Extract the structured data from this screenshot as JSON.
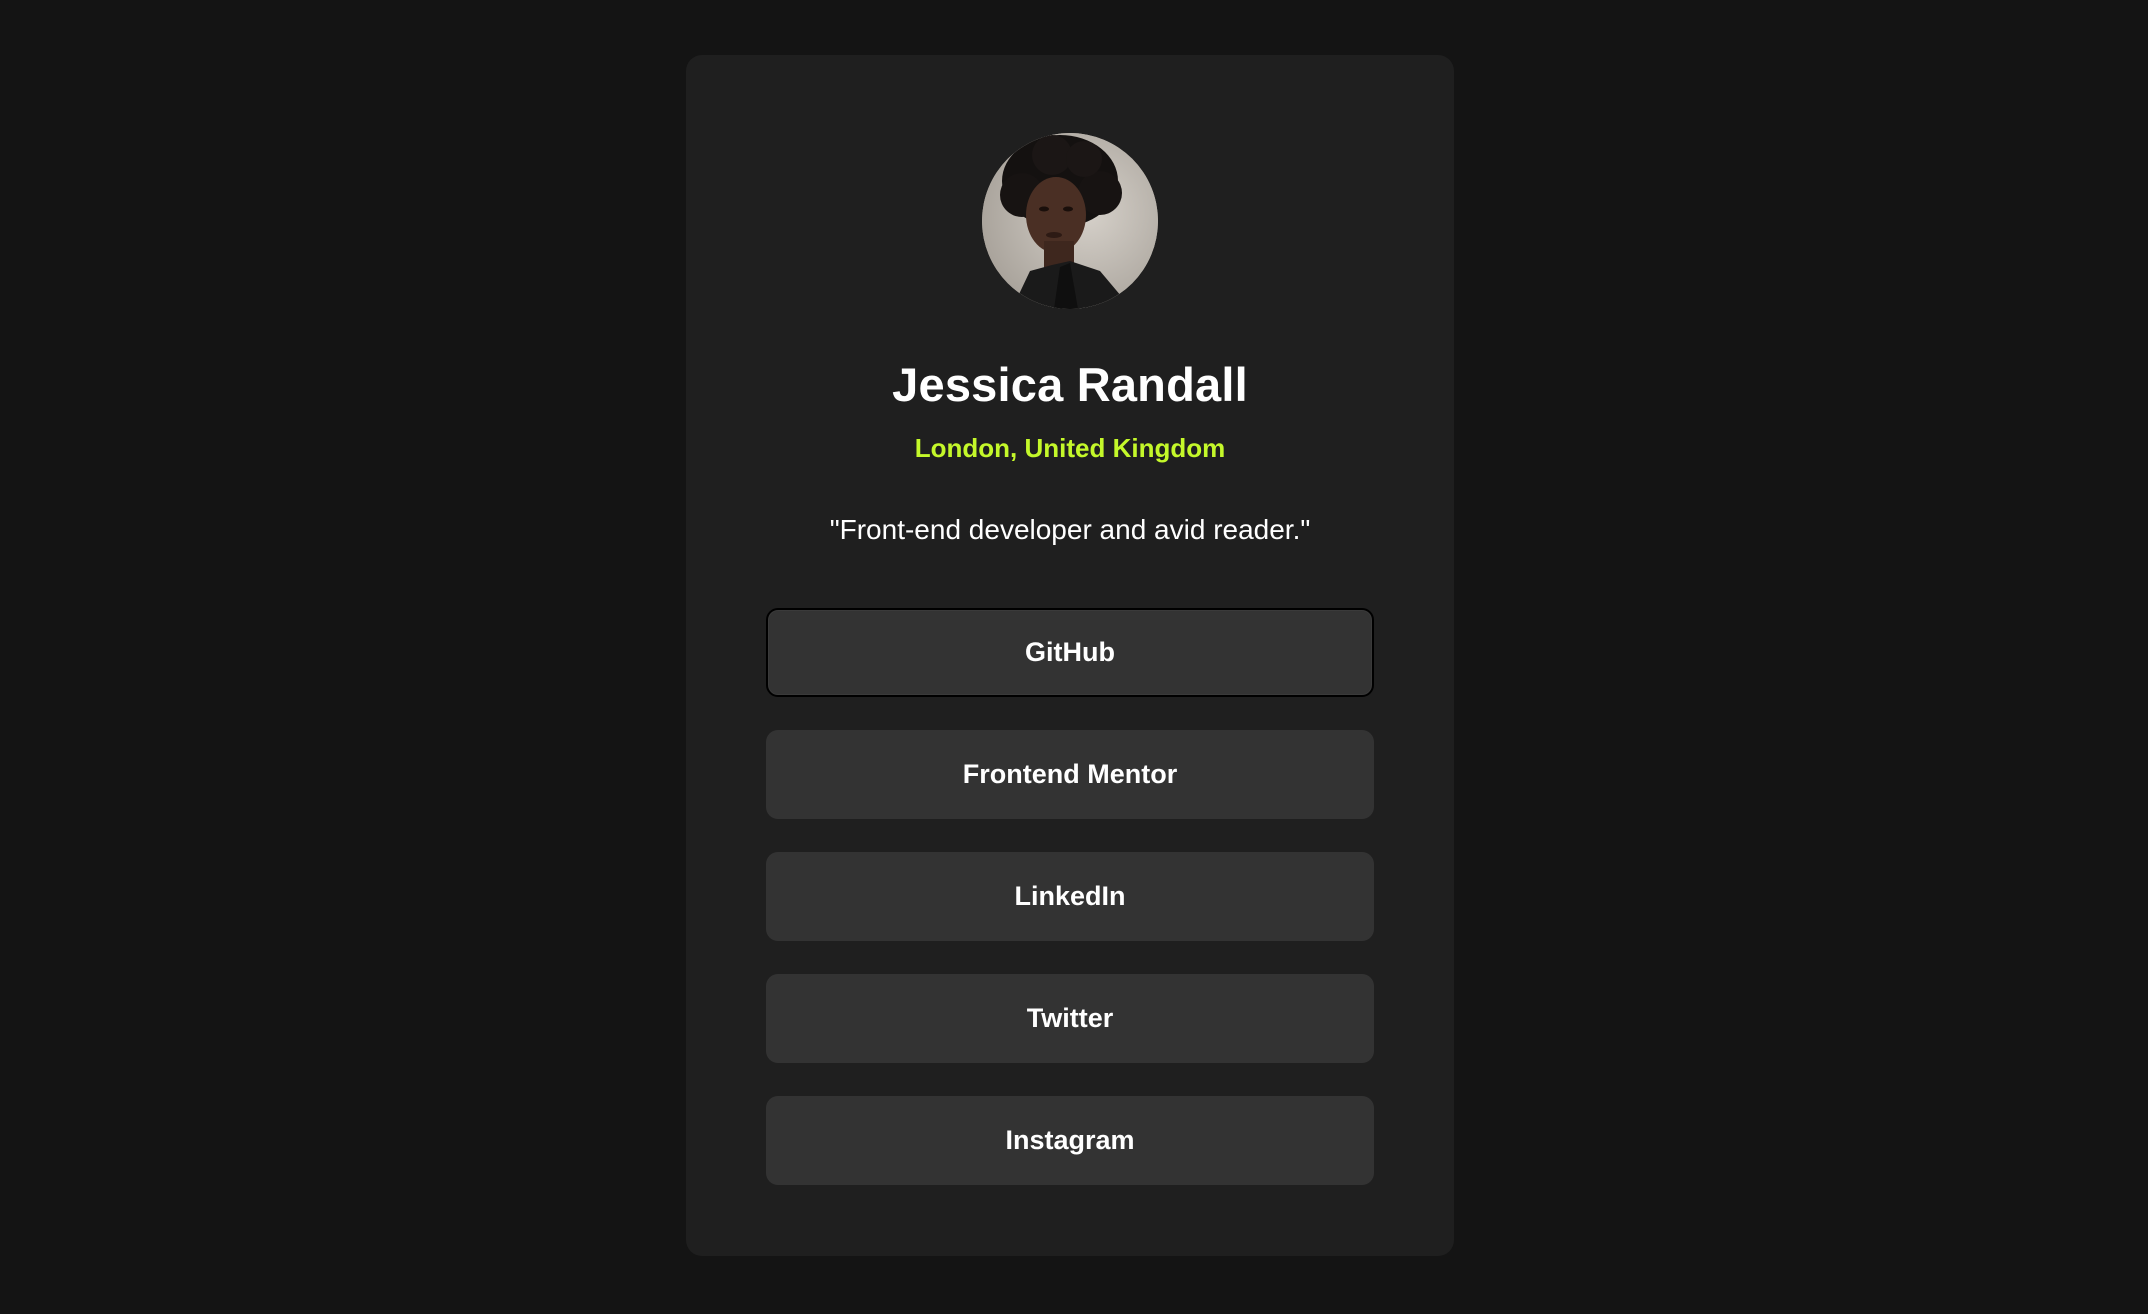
{
  "profile": {
    "name": "Jessica Randall",
    "location": "London, United Kingdom",
    "bio": "\"Front-end developer and avid reader.\"",
    "avatar_icon": "profile-photo"
  },
  "links": [
    {
      "label": "GitHub",
      "focused": true
    },
    {
      "label": "Frontend Mentor"
    },
    {
      "label": "LinkedIn"
    },
    {
      "label": "Twitter"
    },
    {
      "label": "Instagram"
    }
  ],
  "colors": {
    "page_background": "#141414",
    "card_background": "#1f1f1f",
    "button_background": "#333333",
    "accent": "#c4f82a",
    "text": "#ffffff"
  }
}
